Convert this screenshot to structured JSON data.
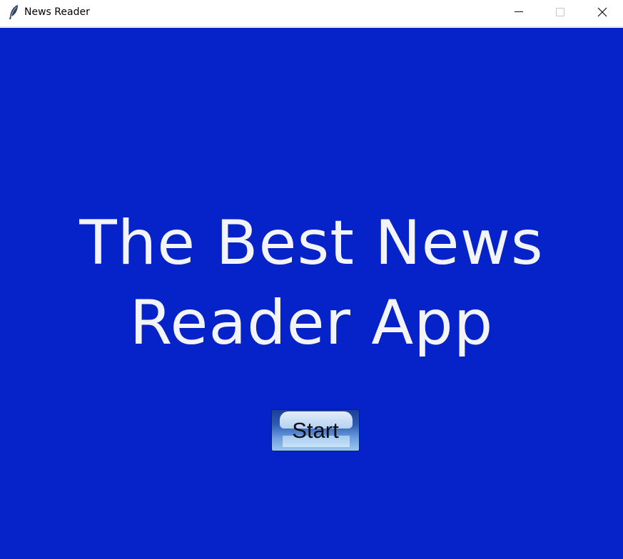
{
  "window": {
    "title": "News Reader",
    "icon": "feather-icon",
    "controls": [
      "minimize-icon",
      "maximize-icon",
      "close-icon"
    ]
  },
  "main": {
    "background_color": "#0622c9",
    "headline_line1": "The Best News",
    "headline_line2": "Reader App",
    "start_button": {
      "label": "Start"
    }
  }
}
